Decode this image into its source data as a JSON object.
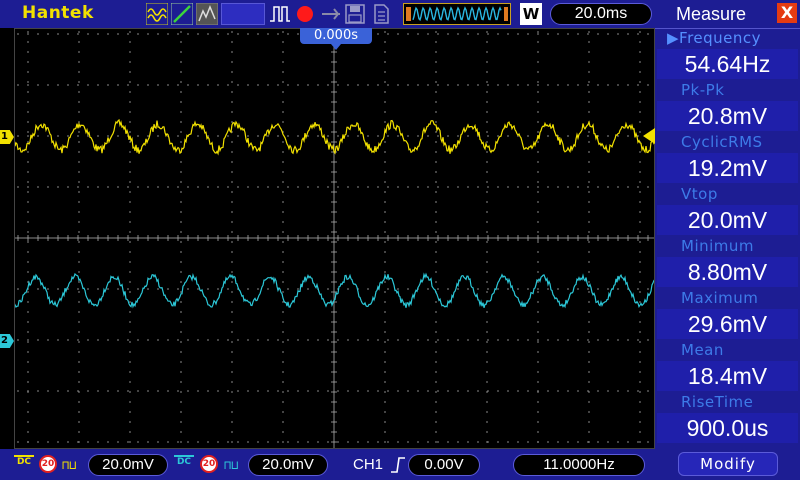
{
  "topbar": {
    "brand": "Hantek",
    "timebase": "20.0ms",
    "mode_icon_label": "W",
    "icons": [
      "waveform-icon",
      "slope-icon",
      "persist-icon",
      "pulse-icon",
      "record-icon",
      "usb-icon",
      "save-icon",
      "file-icon",
      "memory-waveform-icon"
    ]
  },
  "scope": {
    "trigger_time": "0.000s",
    "ch1_marker": "1",
    "ch2_marker": "2",
    "ch1_color": "#f2e100",
    "ch2_color": "#2cc8d8",
    "grid_color": "#8a8a8a"
  },
  "bottombar": {
    "ch1_coupling": "DC",
    "ch1_bw_limit": "20",
    "ch1_volts_div": "20.0mV",
    "ch2_coupling": "DC",
    "ch2_bw_limit": "20",
    "ch2_volts_div": "20.0mV",
    "trigger_source": "CH1",
    "trigger_level": "0.00V",
    "frequency_counter": "11.0000Hz"
  },
  "measure": {
    "title": "Measure",
    "close": "X",
    "items": [
      {
        "label": "Frequency",
        "value": "54.64Hz",
        "selected": true
      },
      {
        "label": "Pk-Pk",
        "value": "20.8mV"
      },
      {
        "label": "CyclicRMS",
        "value": "19.2mV"
      },
      {
        "label": "Vtop",
        "value": "20.0mV"
      },
      {
        "label": "Minimum",
        "value": "8.80mV"
      },
      {
        "label": "Maximum",
        "value": "29.6mV"
      },
      {
        "label": "Mean",
        "value": "18.4mV"
      },
      {
        "label": "RiseTime",
        "value": "900.0us"
      }
    ],
    "modify_label": "Modify"
  }
}
